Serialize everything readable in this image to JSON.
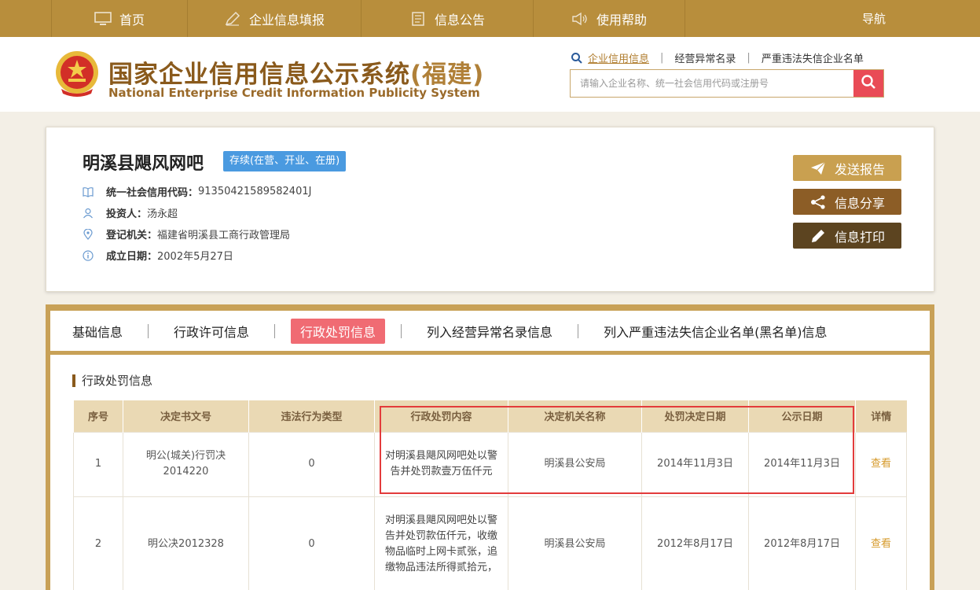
{
  "nav": {
    "items": [
      {
        "label": "首页",
        "icon": "monitor-icon"
      },
      {
        "label": "企业信息填报",
        "icon": "pen-icon"
      },
      {
        "label": "信息公告",
        "icon": "document-icon"
      },
      {
        "label": "使用帮助",
        "icon": "speaker-icon"
      }
    ],
    "guide": "导航"
  },
  "header": {
    "title_cn": "国家企业信用信息公示系统",
    "title_province": "(福建)",
    "title_en": "National Enterprise Credit Information Publicity System",
    "links": [
      "企业信用信息",
      "经营异常名录",
      "严重违法失信企业名单"
    ],
    "search_placeholder": "请输入企业名称、统一社会信用代码或注册号"
  },
  "company": {
    "name": "明溪县飓风网吧",
    "status": "存续(在营、开业、在册)",
    "credit_code_label": "统一社会信用代码：",
    "credit_code": "91350421589582401J",
    "investor_label": "投资人：",
    "investor": "汤永超",
    "registrar_label": "登记机关：",
    "registrar": "福建省明溪县工商行政管理局",
    "founded_label": "成立日期：",
    "founded": "2002年5月27日"
  },
  "actions": {
    "send": "发送报告",
    "share": "信息分享",
    "print": "信息打印"
  },
  "tabs": [
    "基础信息",
    "行政许可信息",
    "行政处罚信息",
    "列入经营异常名录信息",
    "列入严重违法失信企业名单(黑名单)信息"
  ],
  "section_title": "行政处罚信息",
  "table": {
    "headers": [
      "序号",
      "决定书文号",
      "违法行为类型",
      "行政处罚内容",
      "决定机关名称",
      "处罚决定日期",
      "公示日期",
      "详情"
    ],
    "rows": [
      {
        "no": "1",
        "doc": "明公(城关)行罚决2014220",
        "type": "0",
        "content": "对明溪县飓风网吧处以警告并处罚款壹万伍仟元",
        "authority": "明溪县公安局",
        "decision_date": "2014年11月3日",
        "publish_date": "2014年11月3日",
        "detail": "查看"
      },
      {
        "no": "2",
        "doc": "明公决2012328",
        "type": "0",
        "content": "对明溪县飓风网吧处以警告并处罚款伍仟元，收缴物品临时上网卡贰张，追缴物品违法所得贰拾元，",
        "authority": "明溪县公安局",
        "decision_date": "2012年8月17日",
        "publish_date": "2012年8月17日",
        "detail": "查看"
      }
    ]
  },
  "colors": {
    "nav_bg": "#b88e3c",
    "brand_brown": "#8a5a1c",
    "status_blue": "#4a9ae0",
    "active_tab": "#f06b73",
    "highlight_red": "#e33b3b",
    "link_gold": "#d69a2b"
  }
}
